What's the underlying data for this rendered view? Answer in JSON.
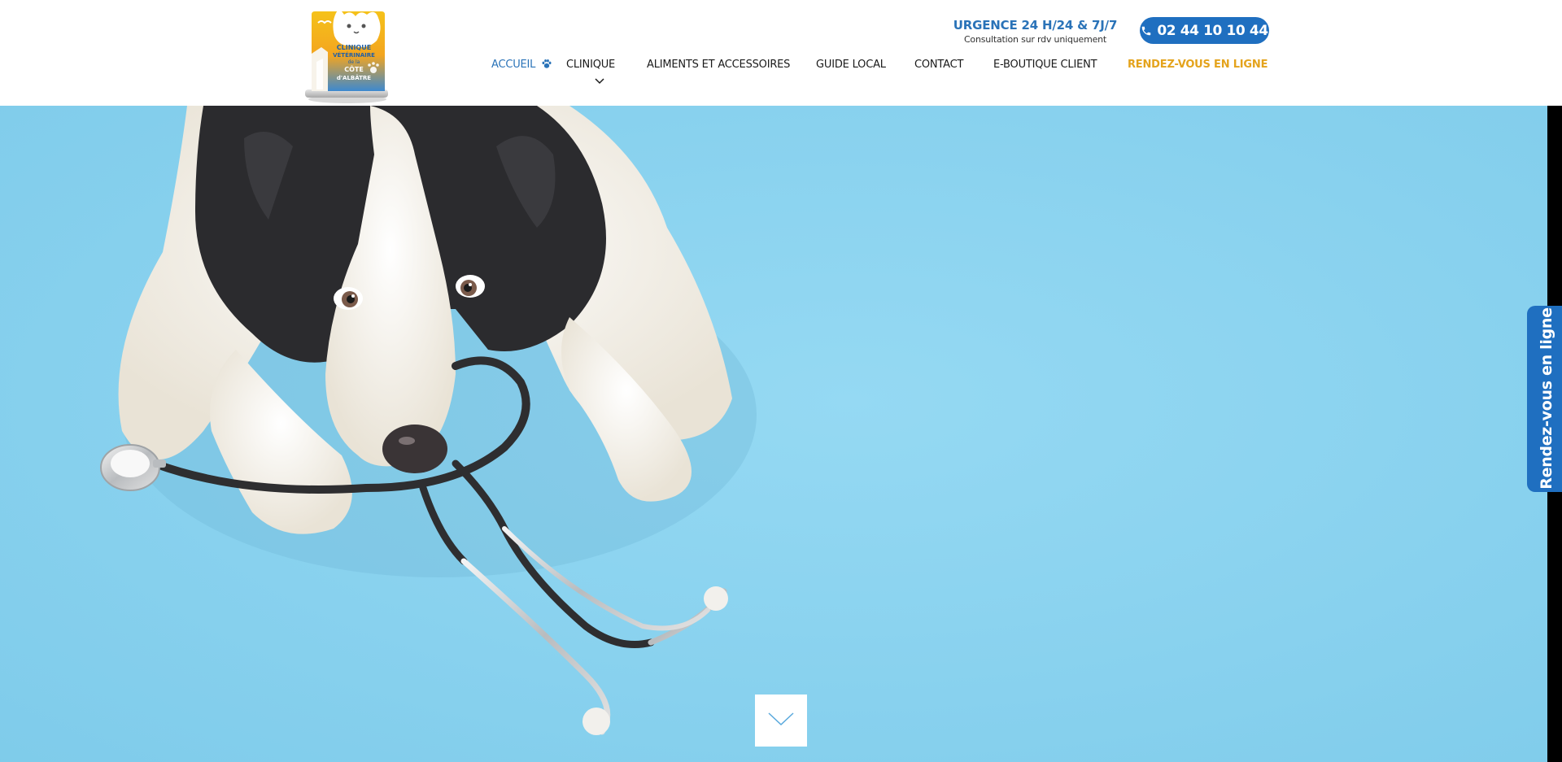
{
  "header": {
    "logo": {
      "alt": "Clinique Vétérinaire de la Côte d'Albâtre",
      "line1": "CLINIQUE",
      "line2": "VÉTÉRINAIRE",
      "line3": "de la",
      "line4": "CÔTE",
      "line5": "d'ALBÂTRE"
    },
    "urgence": {
      "title": "URGENCE 24 H/24 & 7J/7",
      "subtitle": "Consultation sur rdv uniquement"
    },
    "phone": {
      "number": "02 44 10 10 44",
      "icon": "phone-icon"
    }
  },
  "nav": {
    "items": [
      {
        "label": "ACCUEIL",
        "icon": "paw-icon",
        "active": true
      },
      {
        "label": "CLINIQUE",
        "icon": "chevron-down-icon"
      },
      {
        "label": "ALIMENTS ET ACCESSOIRES"
      },
      {
        "label": "GUIDE LOCAL"
      },
      {
        "label": "CONTACT"
      },
      {
        "label": "E-BOUTIQUE CLIENT"
      },
      {
        "label": "RENDEZ-VOUS EN LIGNE",
        "highlight": true
      }
    ]
  },
  "hero": {
    "image": "border-collie puppy with stethoscope on blue background",
    "scroll_icon": "chevron-down-icon"
  },
  "side_tab": {
    "label": "Rendez-vous en ligne"
  },
  "colors": {
    "primary_blue": "#1f6fc0",
    "nav_active": "#2a73b8",
    "rdv_orange": "#e4a31c",
    "hero_background": "#86cfee"
  }
}
